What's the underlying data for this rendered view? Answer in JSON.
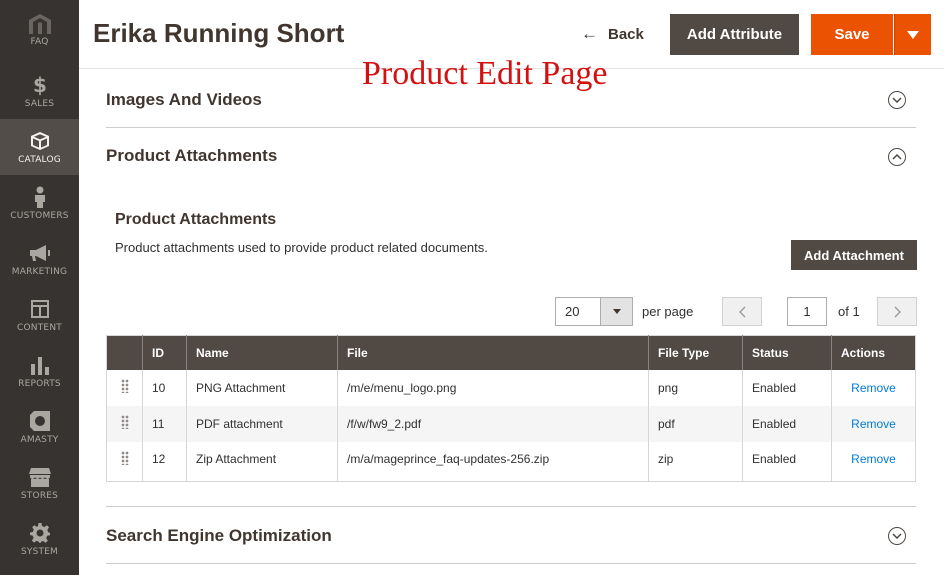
{
  "sidebar": {
    "logo_label": "FAQ",
    "items": [
      {
        "label": "SALES",
        "icon": "dollar-icon"
      },
      {
        "label": "CATALOG",
        "icon": "box-icon",
        "active": true
      },
      {
        "label": "CUSTOMERS",
        "icon": "person-icon"
      },
      {
        "label": "MARKETING",
        "icon": "megaphone-icon"
      },
      {
        "label": "CONTENT",
        "icon": "layout-icon"
      },
      {
        "label": "REPORTS",
        "icon": "bar-chart-icon"
      },
      {
        "label": "AMASTY",
        "icon": "amasty-icon"
      },
      {
        "label": "STORES",
        "icon": "store-icon"
      },
      {
        "label": "SYSTEM",
        "icon": "gear-icon"
      }
    ]
  },
  "header": {
    "title": "Erika Running Short",
    "back_label": "Back",
    "add_attribute_label": "Add Attribute",
    "save_label": "Save"
  },
  "overlay_caption": "Product Edit Page",
  "sections": {
    "images_title": "Images And Videos",
    "attachments_title": "Product Attachments",
    "seo_title": "Search Engine Optimization"
  },
  "attachments": {
    "heading": "Product Attachments",
    "description": "Product attachments used to provide product related documents.",
    "add_button_label": "Add Attachment",
    "pager": {
      "per_page_value": "20",
      "per_page_label": "per page",
      "page_value": "1",
      "of_label": "of 1"
    },
    "columns": [
      "",
      "ID",
      "Name",
      "File",
      "File Type",
      "Status",
      "Actions"
    ],
    "rows": [
      {
        "id": "10",
        "name": "PNG Attachment",
        "file": "/m/e/menu_logo.png",
        "type": "png",
        "status": "Enabled",
        "action": "Remove"
      },
      {
        "id": "11",
        "name": "PDF attachment",
        "file": "/f/w/fw9_2.pdf",
        "type": "pdf",
        "status": "Enabled",
        "action": "Remove"
      },
      {
        "id": "12",
        "name": "Zip Attachment",
        "file": "/m/a/mageprince_faq-updates-256.zip",
        "type": "zip",
        "status": "Enabled",
        "action": "Remove"
      }
    ]
  },
  "colors": {
    "sidebar_bg": "#373330",
    "accent_orange": "#eb5202",
    "dark_button": "#514943",
    "link_blue": "#007bdb",
    "caption_red": "#d41111"
  }
}
